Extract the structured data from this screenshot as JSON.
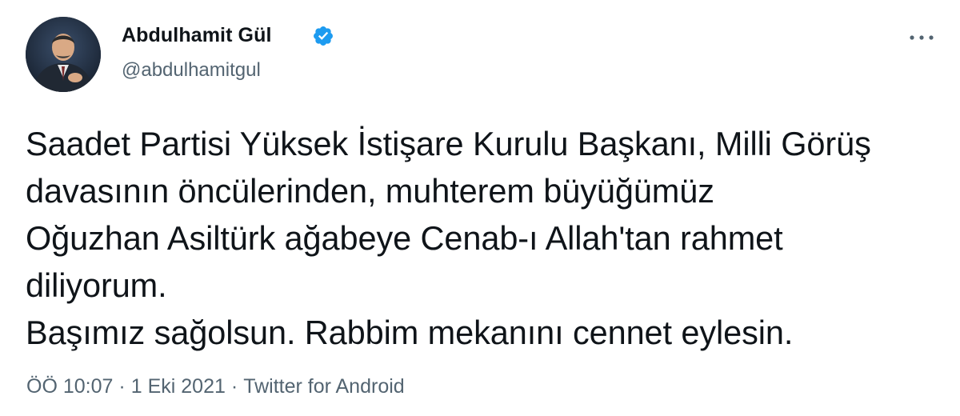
{
  "author": {
    "name": "Abdulhamit Gül",
    "handle": "@abdulhamitgul",
    "verified": true
  },
  "tweet": {
    "lines": [
      "Saadet Partisi Yüksek İstişare Kurulu Başkanı, Milli Görüş",
      "davasının öncülerinden, muhterem büyüğümüz",
      "Oğuzhan Asiltürk ağabeye Cenab-ı Allah'tan rahmet",
      "diliyorum.",
      "Başımız sağolsun. Rabbim mekanını cennet eylesin."
    ]
  },
  "meta": {
    "time": "ÖÖ 10:07",
    "separator": "·",
    "date": "1 Eki 2021",
    "source": "Twitter for Android"
  },
  "icons": {
    "verified": "verified-badge-icon",
    "more": "more-options-icon"
  },
  "colors": {
    "verified_blue": "#1d9bf0",
    "text_primary": "#0f1419",
    "text_secondary": "#536471"
  }
}
